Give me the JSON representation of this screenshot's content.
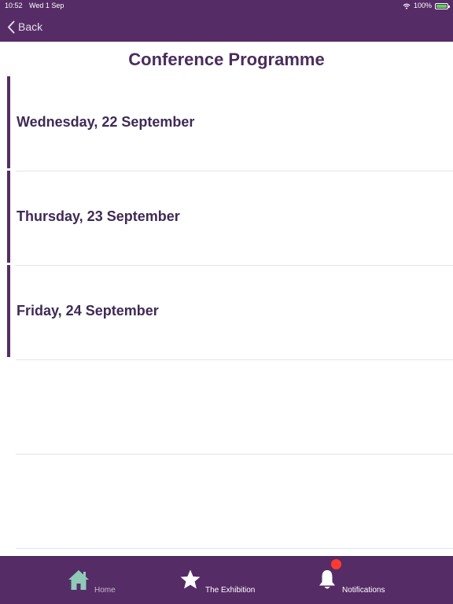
{
  "status_bar": {
    "time": "10:52",
    "date": "Wed 1 Sep",
    "battery": "100%",
    "battery_color": "#5ad35a"
  },
  "nav": {
    "back_label": "Back",
    "back_icon": "chevron-left-icon"
  },
  "page": {
    "title": "Conference Programme"
  },
  "days": [
    {
      "label": "Wednesday, 22 September"
    },
    {
      "label": "Thursday, 23 September"
    },
    {
      "label": "Friday, 24 September"
    }
  ],
  "tab_bar": {
    "background": "#562c66",
    "tabs": [
      {
        "label": "Home",
        "icon": "home-icon",
        "active": true
      },
      {
        "label": "The Exhibition",
        "icon": "star-icon",
        "active": false
      },
      {
        "label": "Notifications",
        "icon": "bell-icon",
        "active": false,
        "has_badge": true
      }
    ]
  },
  "colors": {
    "brand": "#562c66",
    "title_text": "#4a2d5c",
    "home_icon": "#8fcab8",
    "badge": "#ff3b30"
  }
}
